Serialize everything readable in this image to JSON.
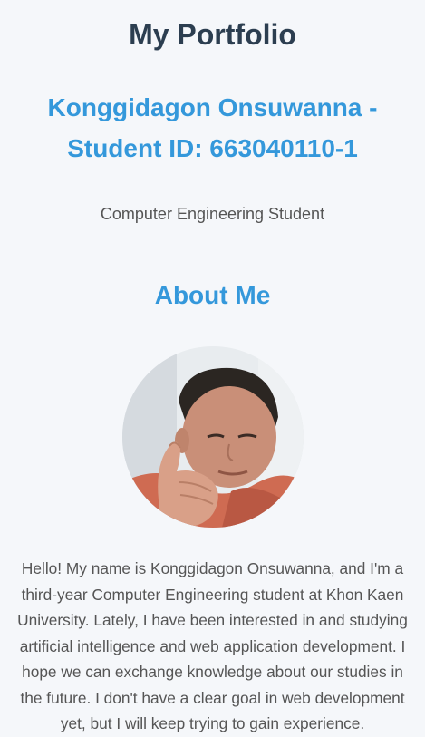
{
  "header": {
    "title": "My Portfolio",
    "name_line": "Konggidagon Onsuwanna - Student ID: 663040110-1",
    "role": "Computer Engineering Student"
  },
  "about": {
    "heading": "About Me",
    "photo_icon": "profile-photo",
    "bio": "Hello! My name is Konggidagon Onsuwanna, and I'm a third-year Computer Engineering student at Khon Kaen University. Lately, I have been interested in and studying artificial intelligence and web application development. I hope we can exchange knowledge about our studies in the future. I don't have a clear goal in web development yet, but I will keep trying to gain experience."
  },
  "colors": {
    "background": "#f5f7fa",
    "title": "#2c3e50",
    "accent": "#3498db",
    "body_text": "#555555"
  }
}
